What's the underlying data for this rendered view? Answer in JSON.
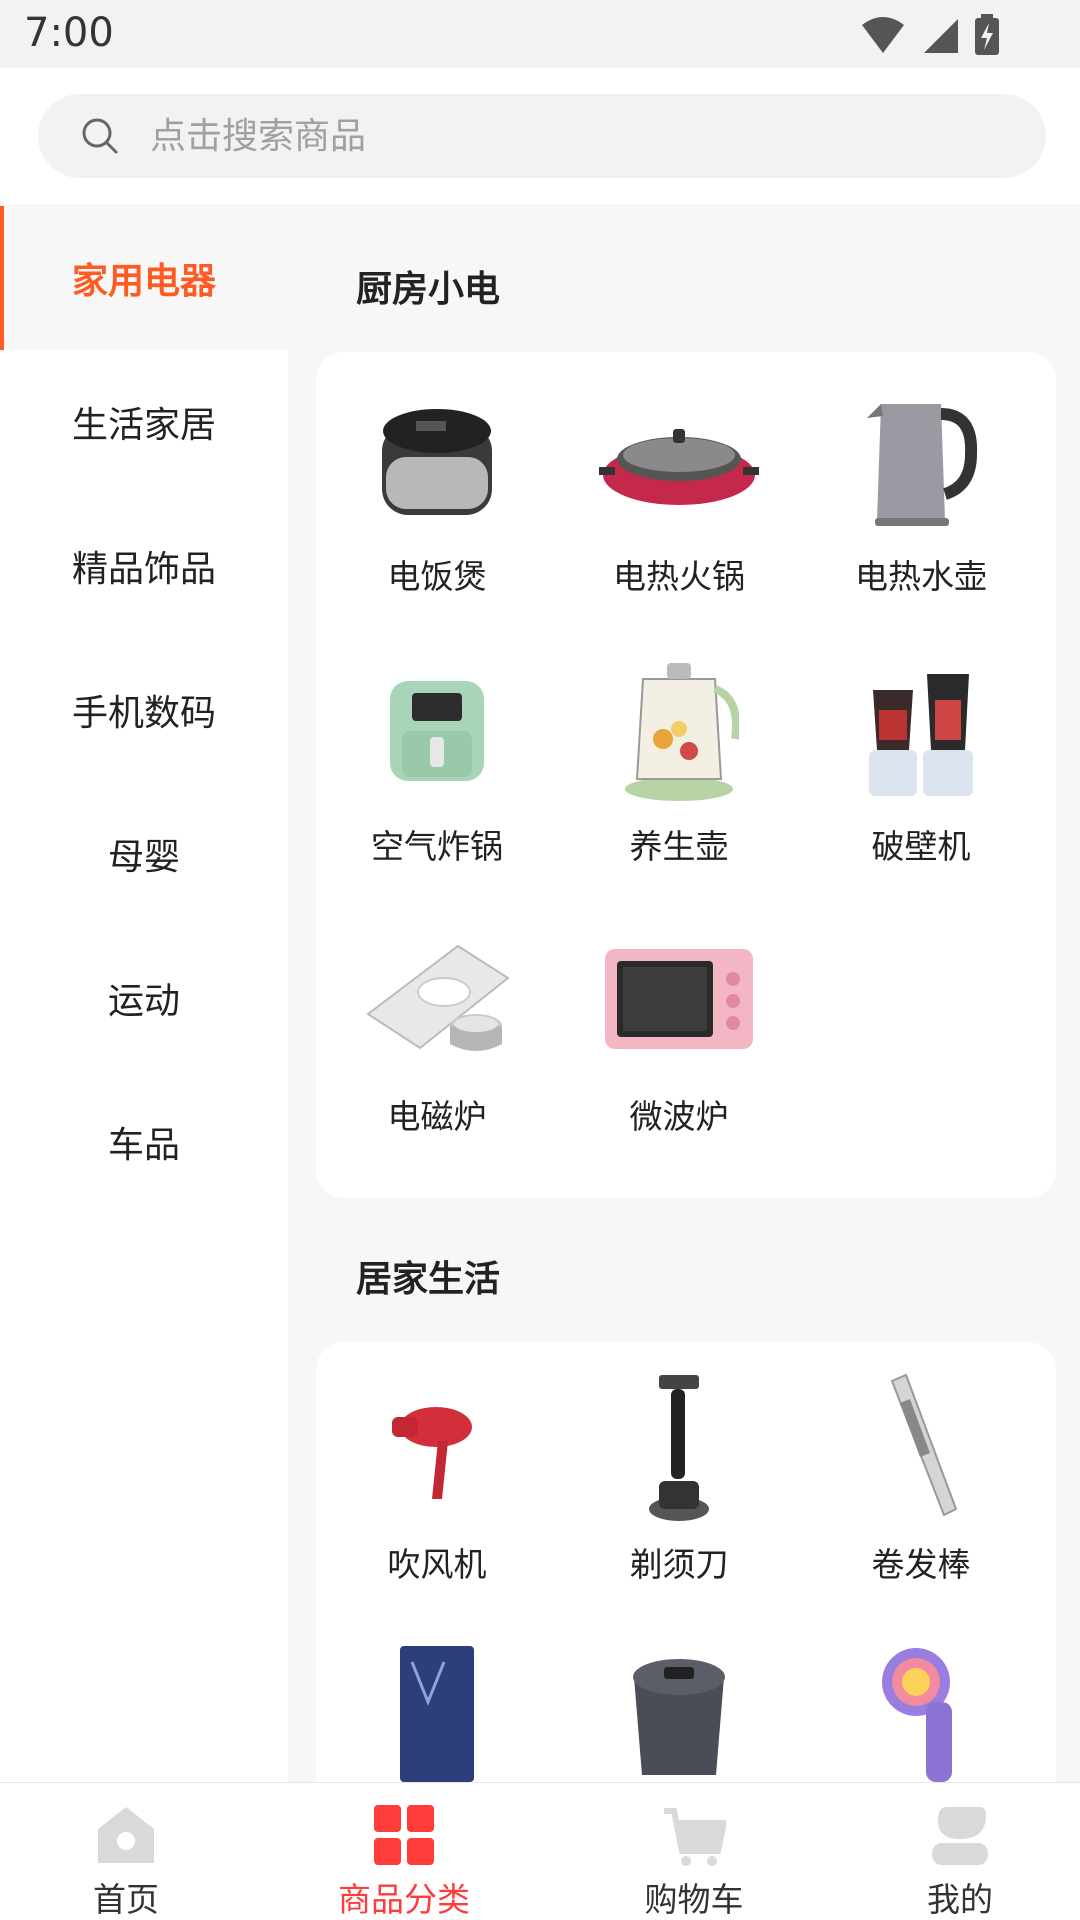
{
  "status_bar": {
    "time": "7:00"
  },
  "search": {
    "placeholder": "点击搜索商品"
  },
  "sidebar": {
    "items": [
      {
        "label": "家用电器",
        "active": true
      },
      {
        "label": "生活家居"
      },
      {
        "label": "精品饰品"
      },
      {
        "label": "手机数码"
      },
      {
        "label": "母婴"
      },
      {
        "label": "运动"
      },
      {
        "label": "车品"
      }
    ]
  },
  "sections": [
    {
      "title": "厨房小电",
      "items": [
        {
          "label": "电饭煲",
          "icon": "rice-cooker-icon"
        },
        {
          "label": "电热火锅",
          "icon": "hot-pot-icon"
        },
        {
          "label": "电热水壶",
          "icon": "kettle-icon"
        },
        {
          "label": "空气炸锅",
          "icon": "air-fryer-icon"
        },
        {
          "label": "养生壶",
          "icon": "health-pot-icon"
        },
        {
          "label": "破壁机",
          "icon": "blender-icon"
        },
        {
          "label": "电磁炉",
          "icon": "induction-cooker-icon"
        },
        {
          "label": "微波炉",
          "icon": "microwave-icon"
        }
      ]
    },
    {
      "title": "居家生活",
      "items": [
        {
          "label": "吹风机",
          "icon": "hair-dryer-icon"
        },
        {
          "label": "剃须刀",
          "icon": "razor-icon"
        },
        {
          "label": "卷发棒",
          "icon": "curling-iron-icon"
        },
        {
          "label": "",
          "icon": "wardrobe-dryer-icon"
        },
        {
          "label": "",
          "icon": "trash-bin-icon"
        },
        {
          "label": "",
          "icon": "lint-remover-icon"
        }
      ]
    }
  ],
  "bottom_nav": [
    {
      "label": "首页",
      "icon": "home-icon"
    },
    {
      "label": "商品分类",
      "icon": "category-icon",
      "active": true
    },
    {
      "label": "购物车",
      "icon": "cart-icon"
    },
    {
      "label": "我的",
      "icon": "profile-icon"
    }
  ],
  "colors": {
    "accent": "#ff5a22",
    "nav_active": "#ff3b3b"
  }
}
